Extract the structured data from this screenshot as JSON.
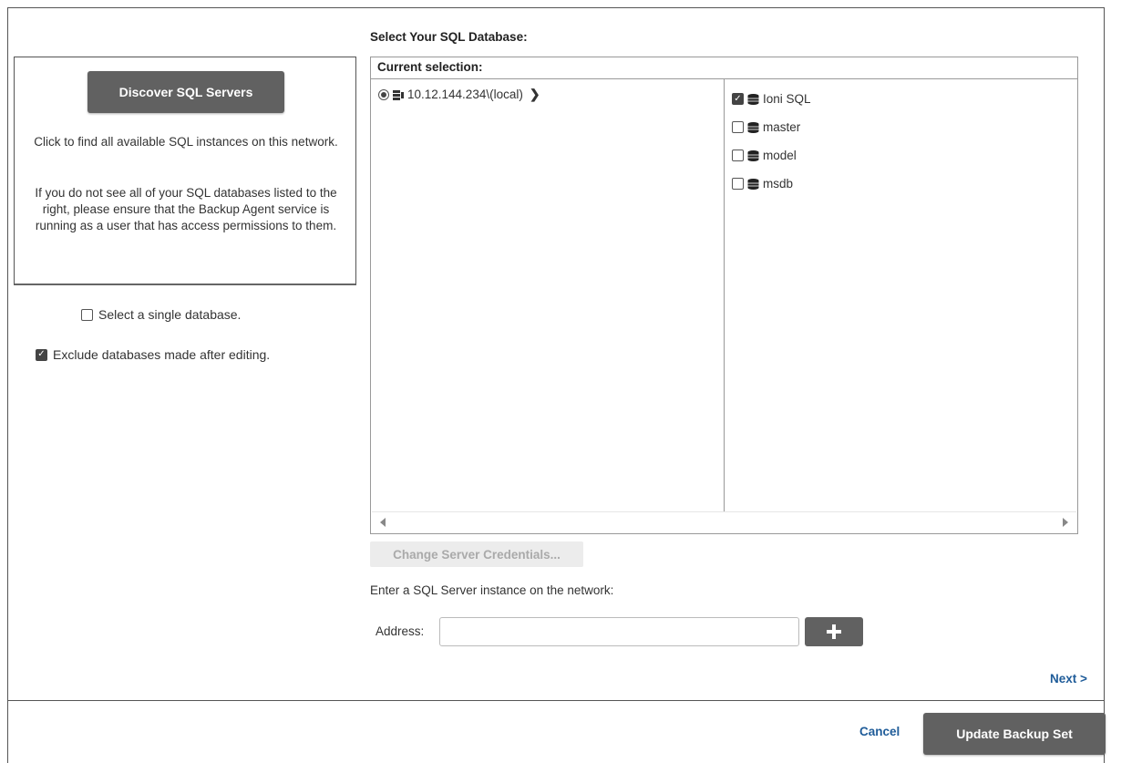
{
  "left": {
    "discover_label": "Discover SQL Servers",
    "help_1": "Click to find all available SQL instances on this network.",
    "help_2": "If you do not see all of your SQL databases listed to the right, please ensure that the Backup Agent service is running as a user that has access permissions to them.",
    "single_db_label": "Select a single database.",
    "single_db_checked": false,
    "exclude_label": "Exclude databases made after editing.",
    "exclude_checked": true
  },
  "main": {
    "title": "Select Your SQL Database:",
    "current_selection": "Current selection:",
    "server": {
      "name": "10.12.144.234\\(local)",
      "selected": true
    },
    "databases": [
      {
        "name": "Ioni SQL",
        "checked": true
      },
      {
        "name": "master",
        "checked": false
      },
      {
        "name": "model",
        "checked": false
      },
      {
        "name": "msdb",
        "checked": false
      }
    ],
    "change_credentials_label": "Change Server Credentials...",
    "enter_instance_label": "Enter a SQL Server instance on the network:",
    "address_label": "Address:",
    "address_value": ""
  },
  "nav": {
    "next_label": "Next >"
  },
  "footer": {
    "cancel_label": "Cancel",
    "update_label": "Update Backup Set"
  },
  "colors": {
    "button_gray": "#616161",
    "link_blue": "#1f5c99"
  }
}
